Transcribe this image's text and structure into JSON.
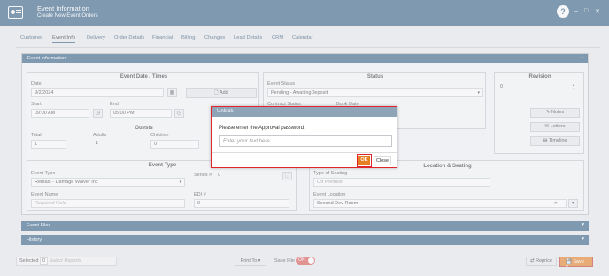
{
  "header": {
    "title": "Event Information",
    "subtitle": "Create New Event Orders",
    "help": "?",
    "minimize": "–",
    "maximize": "□",
    "close": "✕"
  },
  "tabs": [
    "Customer",
    "Event Info",
    "Delivery",
    "Order Details",
    "Financial",
    "Billing",
    "Changes",
    "Lead Details",
    "CRM",
    "Calendar"
  ],
  "panel": {
    "title": "Event Information"
  },
  "dates": {
    "title": "Event Date / Times",
    "date_label": "Date",
    "date_value": "9/2/2024",
    "add_label": "Add",
    "start_label": "Start",
    "start_value": "09:00 AM",
    "end_label": "End",
    "end_value": "05:00 PM"
  },
  "guests": {
    "title": "Guests",
    "total_label": "Total",
    "total_value": "1",
    "adults_label": "Adults",
    "adults_value": "1",
    "children_label": "Children",
    "children_value": "0"
  },
  "status": {
    "title": "Status",
    "event_status_label": "Event Status",
    "event_status_value": "Pending - AwaitingDeposit",
    "contract_status_label": "Contract Status",
    "book_date_label": "Book Date"
  },
  "revision": {
    "title": "Revision",
    "value": "0",
    "notes": "Notes",
    "letters": "Letters",
    "timeline": "Timeline"
  },
  "event_type": {
    "title": "Event Type",
    "type_label": "Event Type",
    "type_value": "Rentals - Damage Waiver Inc",
    "series_label": "Series #",
    "series_value": "0",
    "name_label": "Event Name",
    "name_placeholder": "Required Field",
    "edi_label": "EDI #",
    "edi_value": "0"
  },
  "location": {
    "title": "Location & Seating",
    "seating_label": "Type of Seating",
    "seating_value": "Off Premise",
    "location_label": "Event Location",
    "location_value": "Second Dev Room"
  },
  "sections": {
    "files": "Event Files",
    "history": "History"
  },
  "footer": {
    "selected_label": "Selected",
    "selected_count": "0",
    "reports_placeholder": "Select Reports",
    "print_to": "Print To",
    "save_file": "Save File",
    "toggle": "ON",
    "reprice": "Reprice",
    "save": "Save"
  },
  "modal": {
    "title": "Unlock",
    "prompt": "Please enter the Approval password:",
    "placeholder": "Enter your text here",
    "ok": "OK",
    "close": "Close"
  },
  "colors": {
    "header": "#2f5e82",
    "accent": "#e67e22",
    "highlight": "#e0252d"
  }
}
